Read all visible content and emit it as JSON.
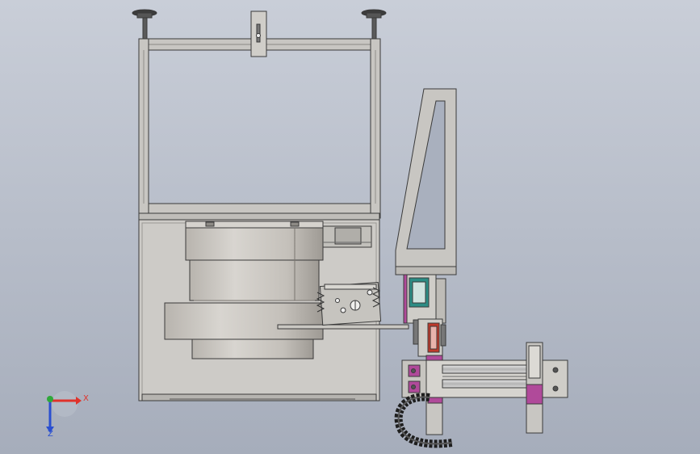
{
  "viewport": {
    "background_top": "#c9ced8",
    "background_bottom": "#a6adbb"
  },
  "model": {
    "steel_color": "#c8c6c2",
    "panel_color": "#cdcbc7",
    "edge_color": "#3a3a3a",
    "accent_magenta": "#b04a9a",
    "accent_teal": "#2c8c84",
    "accent_red": "#c0392b",
    "cable_chain_color": "#1e1e1e"
  },
  "triad": {
    "x_label": "X",
    "z_label": "Z",
    "x_color": "#e0322a",
    "y_color": "#2fa83a",
    "z_color": "#2a4fd0",
    "icon": "coordinate-triad-icon"
  }
}
